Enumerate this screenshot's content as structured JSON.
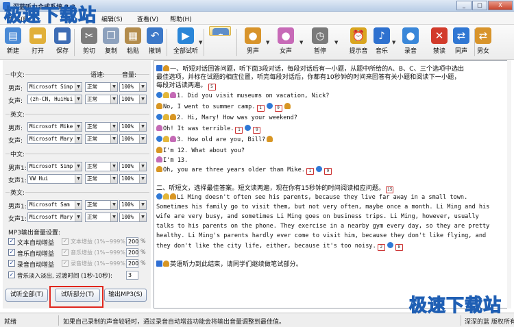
{
  "app": {
    "title": "深蓝听力合成系统 2.2",
    "watermark": "极速下载站",
    "window_buttons": [
      "_",
      "□",
      "X"
    ]
  },
  "menu": [
    {
      "label": "文件(F)"
    },
    {
      "label": "编辑(S)"
    },
    {
      "label": "查看(V)"
    },
    {
      "label": "帮助(H)"
    }
  ],
  "toolbar": [
    {
      "label": "新建",
      "icon": "new-file-icon",
      "color": "#4a8ad6"
    },
    {
      "label": "打开",
      "icon": "open-folder-icon",
      "color": "#e1b03a"
    },
    {
      "label": "保存",
      "icon": "save-disk-icon",
      "color": "#3e6db5"
    },
    {
      "label": "剪切",
      "icon": "scissors-icon",
      "color": "#7c7c7c"
    },
    {
      "label": "复制",
      "icon": "copy-icon",
      "color": "#8da1bd"
    },
    {
      "label": "粘贴",
      "icon": "paste-icon",
      "color": "#b38c4c"
    },
    {
      "label": "撤销",
      "icon": "undo-icon",
      "color": "#3c78c8"
    },
    {
      "label": "全部试听",
      "icon": "play-icon",
      "color": "#2a86d8"
    },
    {
      "label": "设置",
      "icon": "gear-icon",
      "color": "#5f8ec9"
    },
    {
      "label": "男声",
      "icon": "male-voice-icon",
      "color": "#d8942b"
    },
    {
      "label": "女声",
      "icon": "female-voice-icon",
      "color": "#c76ab7"
    },
    {
      "label": "暂停",
      "icon": "pause-clock-icon",
      "color": "#7a7a7a"
    },
    {
      "label": "提示音",
      "icon": "alarm-icon",
      "color": "#d9a51f"
    },
    {
      "label": "音乐",
      "icon": "music-note-icon",
      "color": "#2e71cf"
    },
    {
      "label": "录音",
      "icon": "microphone-icon",
      "color": "#3a87d9"
    },
    {
      "label": "禁读",
      "icon": "forbid-read-icon",
      "color": "#d23b2b"
    },
    {
      "label": "同声",
      "icon": "same-voice-icon",
      "color": "#3077d3"
    },
    {
      "label": "男女",
      "icon": "male-female-icon",
      "color": "#d8942b"
    }
  ],
  "settings": {
    "col_speed": "语速:",
    "col_volume": "音量:",
    "groups": [
      {
        "title": "中文:",
        "rows": [
          {
            "label": "男声:",
            "voice": "Microsoft Simp",
            "speed": "正常",
            "volume": "100%"
          },
          {
            "label": "女声:",
            "voice": "(zh-CN, HuiHui",
            "speed": "正常",
            "volume": "100%"
          }
        ]
      },
      {
        "title": "英文:",
        "rows": [
          {
            "label": "男声:",
            "voice": "Microsoft Mike",
            "speed": "正常",
            "volume": "100%"
          },
          {
            "label": "女声:",
            "voice": "Microsoft Mary",
            "speed": "正常",
            "volume": "100%"
          }
        ]
      },
      {
        "title": "中文:",
        "rows": [
          {
            "label": "男声1:",
            "voice": "Microsoft Simp",
            "speed": "正常",
            "volume": "100%"
          },
          {
            "label": "女声1:",
            "voice": "VW Hui",
            "speed": "正常",
            "volume": "100%"
          }
        ]
      },
      {
        "title": "英文:",
        "rows": [
          {
            "label": "男声1:",
            "voice": "Microsoft Sam",
            "speed": "正常",
            "volume": "100%"
          },
          {
            "label": "女声1:",
            "voice": "Microsoft Mary",
            "speed": "正常",
            "volume": "100%"
          }
        ]
      }
    ],
    "mp3_title": "MP3输出音量设置:",
    "mp3_rows": [
      {
        "label": "文本自动增益",
        "gain_label": "文本增益 (1%~999%)",
        "gain_value": "200",
        "unit": "%"
      },
      {
        "label": "音乐自动增益",
        "gain_label": "音乐增益 (1%~999%)",
        "gain_value": "200",
        "unit": "%"
      },
      {
        "label": "录音自动增益",
        "gain_label": "录音增益 (1%~999%)",
        "gain_value": "200",
        "unit": "%"
      }
    ],
    "fade_label": "音乐淡入淡出, 过渡时间 (1秒-10秒):",
    "fade_value": "3",
    "buttons": {
      "preview_all": "试听全部(T)",
      "preview_part": "试听部分(T)",
      "export_mp3": "输出MP3(S)"
    }
  },
  "document": {
    "lines": [
      {
        "text": "一、听短对话回答问题，听下面3段对话，每段对话后有一小题，从题中所给的A、B、C、三个选项中选出",
        "pre": [
          "note",
          "man"
        ],
        "post": []
      },
      {
        "text": "最佳选项，并标在试题的相应位置，听完每段对话后，你都有10秒钟的时间来回答有关小题和阅读下一小题，",
        "pre": [],
        "post": []
      },
      {
        "text": "每段对话读两遍。",
        "pre": [],
        "post": [
          "cal:5"
        ]
      },
      {
        "text": "1. Did you visit museums on vacation, Nick?",
        "pre": [
          "loop",
          "bell",
          "woman"
        ],
        "post": [],
        "mono": true
      },
      {
        "text": "No, I went to summer camp.",
        "pre": [
          "man"
        ],
        "post": [
          "cal:1",
          "loop",
          "cal:9",
          "man"
        ],
        "mono": true
      },
      {
        "text": "2. Hi, Mary! How was your weekend?",
        "pre": [
          "loop",
          "bell",
          "man"
        ],
        "post": [],
        "mono": true
      },
      {
        "text": "Oh! It was terrible.",
        "pre": [
          "woman"
        ],
        "post": [
          "cal:1",
          "loop",
          "cal:9"
        ],
        "mono": true
      },
      {
        "text": "3. How old are you, Bill?",
        "pre": [
          "loop",
          "bell",
          "woman"
        ],
        "post": [
          "man"
        ],
        "mono": true
      },
      {
        "text": "I'm 12. What about you?",
        "pre": [
          "man"
        ],
        "post": [],
        "mono": true
      },
      {
        "text": "I'm 13.",
        "pre": [
          "woman"
        ],
        "post": [],
        "mono": true
      },
      {
        "text": "Oh, you are three years older than Mike.",
        "pre": [
          "man"
        ],
        "post": [
          "cal:1",
          "loop",
          "cal:9"
        ],
        "mono": true
      },
      {
        "text": "二、听短文，选择最佳答案。短文读两遍，现在你有15秒钟的时间阅读相应问题。",
        "pre": [],
        "post": [
          "cal:15"
        ]
      },
      {
        "text": "Li Ming doesn't often see his parents, because they live far away in a small town.",
        "pre": [
          "loop",
          "bell",
          "man"
        ],
        "post": [],
        "mono": true
      },
      {
        "text": "Sometimes his family go to visit them, but not very often, maybe once a month.  Li Ming and his",
        "pre": [],
        "post": [],
        "mono": true
      },
      {
        "text": "wife are very busy, and sometimes Li Ming goes on business trips.  Li Ming, however, usually",
        "pre": [],
        "post": [],
        "mono": true
      },
      {
        "text": "talks to his parents on the phone.  They exercise in a nearby gym every day, so they are pretty",
        "pre": [],
        "post": [],
        "mono": true
      },
      {
        "text": "healthy.  Li Ming's parents hardly ever come to visit him, because they don't like flying, and",
        "pre": [],
        "post": [],
        "mono": true
      },
      {
        "text": "they don't like the city life, either, because it's too noisy.",
        "pre": [],
        "post": [
          "cal:2",
          "loop",
          "cal:8"
        ],
        "mono": true
      },
      {
        "text": "英语听力到此结束，请同学们继续做笔试部分。",
        "pre": [
          "note",
          "man"
        ],
        "post": []
      }
    ]
  },
  "status": {
    "state": "就绪",
    "tip": "如果自己录制的声音较轻时，通过录音自动增益功能会将输出音量调整到最佳值。",
    "copyright": "深深的蓝 版权所有"
  }
}
